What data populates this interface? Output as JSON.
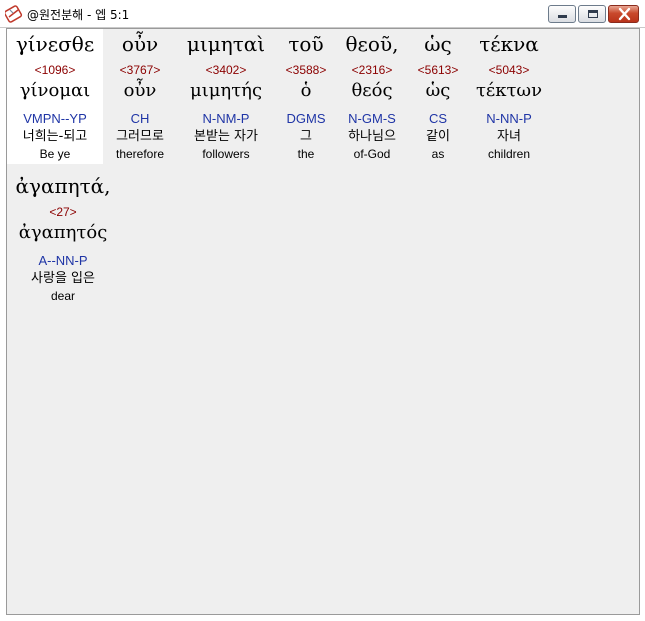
{
  "window": {
    "title": "@원전분해 - 엡 5:1"
  },
  "words": [
    {
      "greek": "γίνεσθε",
      "strong": "<1096>",
      "lemma": "γίνομαι",
      "morph": "VMPN--YP",
      "korean": "너희는-되고",
      "english": "Be ye",
      "selected": true
    },
    {
      "greek": "οὖν",
      "strong": "<3767>",
      "lemma": "οὖν",
      "morph": "CH",
      "korean": "그러므로",
      "english": "therefore",
      "selected": false
    },
    {
      "greek": "μιμηταὶ",
      "strong": "<3402>",
      "lemma": "μιμητής",
      "morph": "N-NM-P",
      "korean": "본받는 자가",
      "english": "followers",
      "selected": false
    },
    {
      "greek": "τοῦ",
      "strong": "<3588>",
      "lemma": "ὁ",
      "morph": "DGMS",
      "korean": "그",
      "english": "the",
      "selected": false
    },
    {
      "greek": "θεοῦ,",
      "strong": "<2316>",
      "lemma": "θεός",
      "morph": "N-GM-S",
      "korean": "하나님으",
      "english": "of-God",
      "selected": false
    },
    {
      "greek": "ὡς",
      "strong": "<5613>",
      "lemma": "ὡς",
      "morph": "CS",
      "korean": "같이",
      "english": "as",
      "selected": false
    },
    {
      "greek": "τέκνα",
      "strong": "<5043>",
      "lemma": "τέκτων",
      "morph": "N-NN-P",
      "korean": "자녀",
      "english": "children",
      "selected": false
    },
    {
      "greek": "ἀγαπητά,",
      "strong": "<27>",
      "lemma": "ἀγαπητός",
      "morph": "A--NN-P",
      "korean": "사랑을 입은",
      "english": "dear",
      "selected": false
    }
  ]
}
